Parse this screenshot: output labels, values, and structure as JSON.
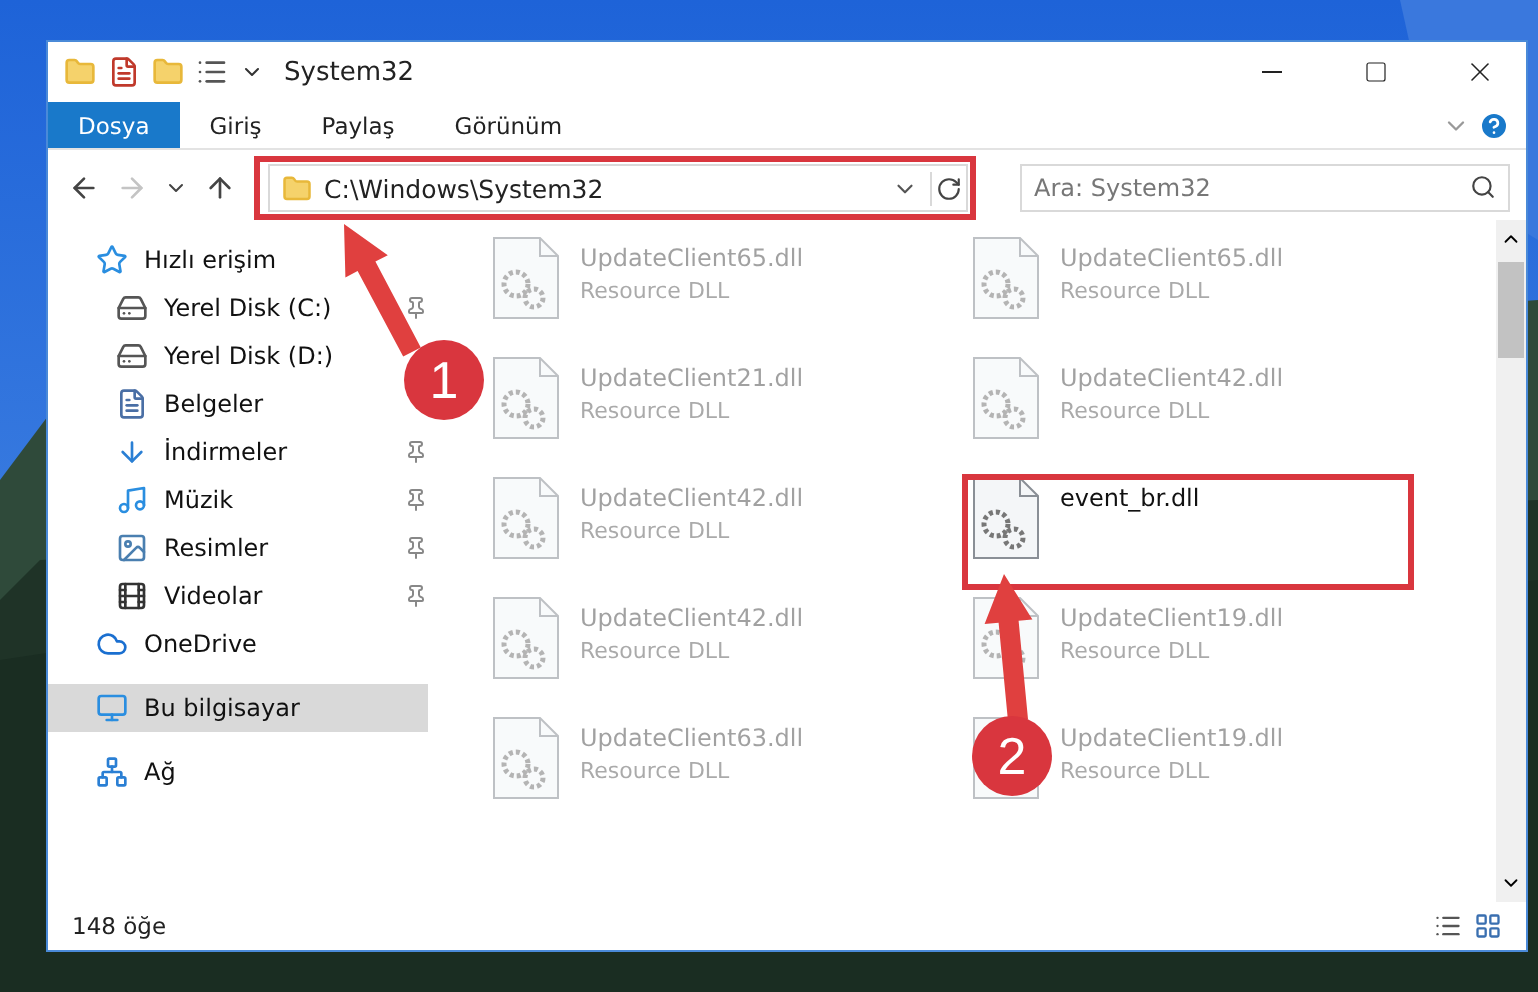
{
  "window": {
    "title": "System32"
  },
  "ribbon": {
    "tabs": [
      {
        "label": "Dosya",
        "selected": true
      },
      {
        "label": "Giriş",
        "selected": false
      },
      {
        "label": "Paylaş",
        "selected": false
      },
      {
        "label": "Görünüm",
        "selected": false
      }
    ]
  },
  "navigation": [
    {
      "kind": "back",
      "disabled": false
    },
    {
      "kind": "forward",
      "disabled": true
    },
    {
      "kind": "recent",
      "disabled": false
    },
    {
      "kind": "up",
      "disabled": false
    }
  ],
  "address": {
    "path": "C:\\Windows\\System32"
  },
  "search": {
    "placeholder": "Ara: System32"
  },
  "sidebar": {
    "items": [
      {
        "label": "Hızlı erişim",
        "kind": "star",
        "selected": false,
        "children": [
          {
            "label": "Yerel Disk (C:)",
            "kind": "drive",
            "pinned": true,
            "selected": false
          },
          {
            "label": "Yerel Disk (D:)",
            "kind": "drive",
            "pinned": false,
            "selected": false
          },
          {
            "label": "Belgeler",
            "kind": "document",
            "pinned": false,
            "selected": false
          },
          {
            "label": "İndirmeler",
            "kind": "download",
            "pinned": true,
            "selected": false
          },
          {
            "label": "Müzik",
            "kind": "music",
            "pinned": true,
            "selected": false
          },
          {
            "label": "Resimler",
            "kind": "pictures",
            "pinned": true,
            "selected": false
          },
          {
            "label": "Videolar",
            "kind": "video",
            "pinned": true,
            "selected": false
          }
        ]
      },
      {
        "label": "OneDrive",
        "kind": "cloud",
        "selected": false
      },
      {
        "label": "Bu bilgisayar",
        "kind": "computer",
        "selected": true
      },
      {
        "label": "Ağ",
        "kind": "network",
        "selected": false
      }
    ]
  },
  "files": [
    {
      "name": "UpdateClient65.dll",
      "type": "Resource DLL",
      "blurred": true
    },
    {
      "name": "UpdateClient65.dll",
      "type": "Resource DLL",
      "blurred": true
    },
    {
      "name": "UpdateClient21.dll",
      "type": "Resource DLL",
      "blurred": true
    },
    {
      "name": "UpdateClient42.dll",
      "type": "Resource DLL",
      "blurred": true
    },
    {
      "name": "UpdateClient42.dll",
      "type": "Resource DLL",
      "blurred": true
    },
    {
      "name": "event_br.dll",
      "blurred": false
    },
    {
      "name": "UpdateClient42.dll",
      "type": "Resource DLL",
      "blurred": true
    },
    {
      "name": "UpdateClient19.dll",
      "type": "Resource DLL",
      "blurred": true
    },
    {
      "name": "UpdateClient63.dll",
      "type": "Resource DLL",
      "blurred": true
    },
    {
      "name": "UpdateClient19.dll",
      "type": "Resource DLL",
      "blurred": true
    }
  ],
  "status_bar": {
    "count": "148 öğe"
  },
  "annotations": [
    {
      "number": "1"
    },
    {
      "number": "2"
    }
  ]
}
